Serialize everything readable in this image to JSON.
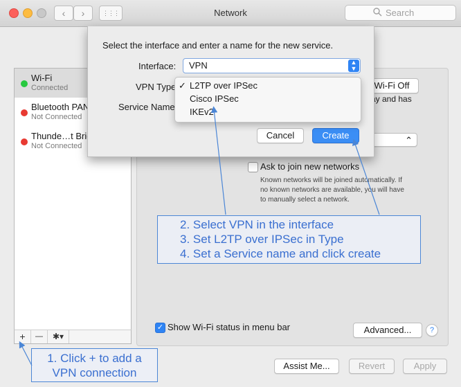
{
  "window": {
    "title": "Network",
    "search_placeholder": "Search",
    "back_glyph": "‹",
    "forward_glyph": "›",
    "grid_glyph": "⋮⋮⋮"
  },
  "sidebar": {
    "items": [
      {
        "name": "Wi-Fi",
        "status": "Connected",
        "dot_color": "#27c93f"
      },
      {
        "name": "Bluetooth PAN",
        "status": "Not Connected",
        "dot_color": "#e83a32"
      },
      {
        "name": "Thunde…t Bridge",
        "status": "Not Connected",
        "dot_color": "#e83a32"
      }
    ],
    "toolbar": {
      "add": "+",
      "remove": "—",
      "gear": "✱▾"
    }
  },
  "main": {
    "wifi_off_button": "Wi-Fi Off",
    "partial_text_1": "ay and has",
    "ask_join_label": "Ask to join new networks",
    "ask_join_help": [
      "Known networks will be joined automatically. If",
      "no known networks are available, you will have",
      "to manually select a network."
    ],
    "show_status_label": "Show Wi-Fi status in menu bar",
    "show_status_checked": true,
    "advanced_button": "Advanced...",
    "help_button": "?",
    "assist_button": "Assist Me...",
    "revert_button": "Revert",
    "apply_button": "Apply"
  },
  "sheet": {
    "prompt": "Select the interface and enter a name for the new service.",
    "interface_label": "Interface:",
    "interface_value": "VPN",
    "vpn_type_label": "VPN Type",
    "service_name_label": "Service Name",
    "cancel_button": "Cancel",
    "create_button": "Create",
    "vpn_type_menu": [
      {
        "label": "L2TP over IPSec",
        "checked": true
      },
      {
        "label": "Cisco IPSec",
        "checked": false
      },
      {
        "label": "IKEv2",
        "checked": false
      }
    ],
    "check_glyph": "✓"
  },
  "annotations": {
    "callout_1": [
      "1. Click + to add a",
      "VPN connection"
    ],
    "callout_2": [
      "2. Select VPN in the interface",
      "3. Set L2TP over IPSec in Type",
      "4. Set a Service name and click create"
    ],
    "color": "#3a6fd0"
  }
}
